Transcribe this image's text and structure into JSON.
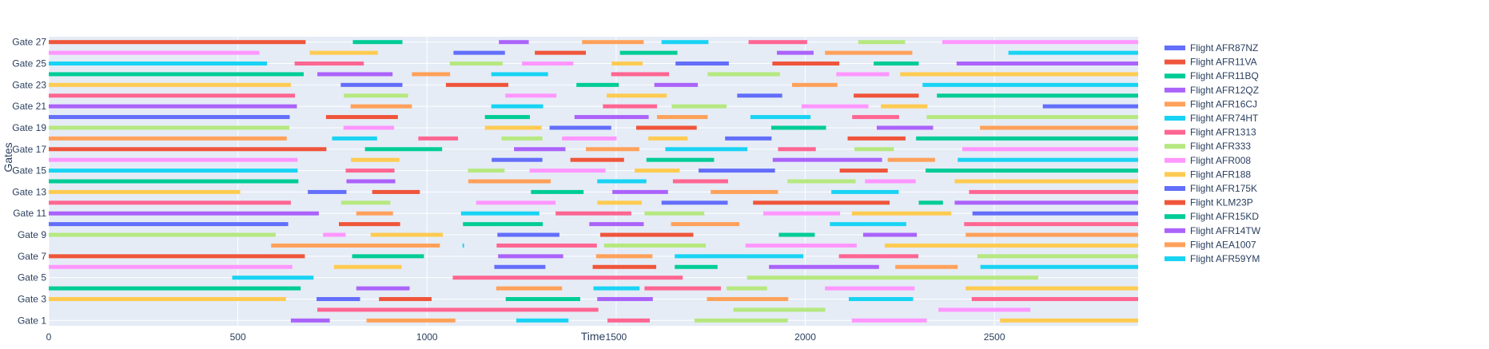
{
  "chart_data": {
    "type": "gantt",
    "title": "",
    "xlabel": "Time",
    "ylabel": "Gates",
    "xlim": [
      0,
      2880
    ],
    "ylim": [
      0.5,
      27.5
    ],
    "x_ticks": [
      0,
      500,
      1000,
      1500,
      2000,
      2500
    ],
    "y_ticks": [
      {
        "value": 1,
        "label": "Gate 1"
      },
      {
        "value": 3,
        "label": "Gate 3"
      },
      {
        "value": 5,
        "label": "Gate 5"
      },
      {
        "value": 7,
        "label": "Gate 7"
      },
      {
        "value": 9,
        "label": "Gate 9"
      },
      {
        "value": 11,
        "label": "Gate 11"
      },
      {
        "value": 13,
        "label": "Gate 13"
      },
      {
        "value": 15,
        "label": "Gate 15"
      },
      {
        "value": 17,
        "label": "Gate 17"
      },
      {
        "value": 19,
        "label": "Gate 19"
      },
      {
        "value": 21,
        "label": "Gate 21"
      },
      {
        "value": 23,
        "label": "Gate 23"
      },
      {
        "value": 25,
        "label": "Gate 25"
      },
      {
        "value": 27,
        "label": "Gate 27"
      }
    ],
    "grid": true,
    "legend_position": "right",
    "palette": [
      "#636efa",
      "#EF553B",
      "#00cc96",
      "#ab63fa",
      "#FFA15A",
      "#19d3f3",
      "#FF6692",
      "#B6E880",
      "#FF97FF",
      "#FECB52"
    ],
    "legend": [
      {
        "name": "Flight AFR87NZ",
        "color": "#636efa"
      },
      {
        "name": "Flight AFR11VA",
        "color": "#EF553B"
      },
      {
        "name": "Flight AFR11BQ",
        "color": "#00cc96"
      },
      {
        "name": "Flight AFR12QZ",
        "color": "#ab63fa"
      },
      {
        "name": "Flight AFR16CJ",
        "color": "#FFA15A"
      },
      {
        "name": "Flight AFR74HT",
        "color": "#19d3f3"
      },
      {
        "name": "Flight AFR1313",
        "color": "#FF6692"
      },
      {
        "name": "Flight AFR333",
        "color": "#B6E880"
      },
      {
        "name": "Flight AFR008",
        "color": "#FF97FF"
      },
      {
        "name": "Flight AFR188",
        "color": "#FECB52"
      },
      {
        "name": "Flight AFR175K",
        "color": "#636efa"
      },
      {
        "name": "Flight KLM23P",
        "color": "#EF553B"
      },
      {
        "name": "Flight AFR15KD",
        "color": "#00cc96"
      },
      {
        "name": "Flight AFR14TW",
        "color": "#ab63fa"
      },
      {
        "name": "Flight AEA1007",
        "color": "#FFA15A"
      },
      {
        "name": "Flight AFR59YM",
        "color": "#19d3f3"
      }
    ],
    "gates": [
      {
        "gate": 1,
        "bars": [
          [
            640,
            743
          ],
          [
            840,
            1075
          ],
          [
            1236,
            1374
          ],
          [
            1477,
            1589
          ],
          [
            1707,
            1954
          ],
          [
            2123,
            2321
          ],
          [
            2515,
            2880
          ]
        ]
      },
      {
        "gate": 2,
        "bars": [
          [
            710,
            1453
          ],
          [
            1810,
            2053
          ],
          [
            2352,
            2595
          ]
        ]
      },
      {
        "gate": 3,
        "bars": [
          [
            0,
            627
          ],
          [
            708,
            823
          ],
          [
            873,
            1012
          ],
          [
            1208,
            1405
          ],
          [
            1450,
            1597
          ],
          [
            1740,
            1955
          ],
          [
            2115,
            2285
          ],
          [
            2440,
            2880
          ]
        ]
      },
      {
        "gate": 4,
        "bars": [
          [
            0,
            666
          ],
          [
            813,
            954
          ],
          [
            1183,
            1357
          ],
          [
            1440,
            1562
          ],
          [
            1575,
            1777
          ],
          [
            1792,
            1899
          ],
          [
            2052,
            2289
          ],
          [
            2424,
            2880
          ]
        ]
      },
      {
        "gate": 5,
        "bars": [
          [
            485,
            700
          ],
          [
            1068,
            1676
          ],
          [
            1846,
            2616
          ]
        ]
      },
      {
        "gate": 6,
        "bars": [
          [
            0,
            644
          ],
          [
            754,
            933
          ],
          [
            1178,
            1313
          ],
          [
            1438,
            1606
          ],
          [
            1655,
            1768
          ],
          [
            1904,
            2195
          ],
          [
            2238,
            2403
          ],
          [
            2463,
            2880
          ]
        ]
      },
      {
        "gate": 7,
        "bars": [
          [
            0,
            677
          ],
          [
            802,
            992
          ],
          [
            1188,
            1360
          ],
          [
            1447,
            1596
          ],
          [
            1655,
            1995
          ],
          [
            2089,
            2299
          ],
          [
            2455,
            2880
          ]
        ]
      },
      {
        "gate": 8,
        "bars": [
          [
            588,
            1034
          ],
          [
            1094,
            1098
          ],
          [
            1184,
            1449
          ],
          [
            1468,
            1737
          ],
          [
            1842,
            2136
          ],
          [
            2210,
            2880
          ]
        ]
      },
      {
        "gate": 9,
        "bars": [
          [
            0,
            600
          ],
          [
            725,
            785
          ],
          [
            851,
            1042
          ],
          [
            1186,
            1350
          ],
          [
            1458,
            1704
          ],
          [
            1930,
            2025
          ],
          [
            2153,
            2295
          ],
          [
            2424,
            2880
          ]
        ]
      },
      {
        "gate": 10,
        "bars": [
          [
            0,
            633
          ],
          [
            767,
            929
          ],
          [
            1095,
            1306
          ],
          [
            1429,
            1573
          ],
          [
            1645,
            1826
          ],
          [
            2065,
            2267
          ],
          [
            2420,
            2880
          ]
        ]
      },
      {
        "gate": 11,
        "bars": [
          [
            0,
            714
          ],
          [
            813,
            910
          ],
          [
            1090,
            1297
          ],
          [
            1340,
            1540
          ],
          [
            1575,
            1733
          ],
          [
            1889,
            2092
          ],
          [
            2123,
            2386
          ],
          [
            2442,
            2880
          ]
        ]
      },
      {
        "gate": 12,
        "bars": [
          [
            0,
            640
          ],
          [
            773,
            903
          ],
          [
            1130,
            1340
          ],
          [
            1450,
            1568
          ],
          [
            1620,
            1795
          ],
          [
            1862,
            2223
          ],
          [
            2300,
            2364
          ],
          [
            2395,
            2880
          ]
        ]
      },
      {
        "gate": 13,
        "bars": [
          [
            0,
            506
          ],
          [
            685,
            787
          ],
          [
            855,
            981
          ],
          [
            1275,
            1414
          ],
          [
            1490,
            1637
          ],
          [
            1750,
            1928
          ],
          [
            2069,
            2247
          ],
          [
            2433,
            2880
          ]
        ]
      },
      {
        "gate": 14,
        "bars": [
          [
            0,
            660
          ],
          [
            787,
            916
          ],
          [
            1109,
            1327
          ],
          [
            1450,
            1580
          ],
          [
            1650,
            1796
          ],
          [
            1953,
            2133
          ],
          [
            2158,
            2292
          ],
          [
            2395,
            2880
          ]
        ]
      },
      {
        "gate": 15,
        "bars": [
          [
            0,
            658
          ],
          [
            785,
            914
          ],
          [
            1108,
            1205
          ],
          [
            1271,
            1472
          ],
          [
            1549,
            1668
          ],
          [
            1718,
            1920
          ],
          [
            2091,
            2218
          ],
          [
            2318,
            2880
          ]
        ]
      },
      {
        "gate": 16,
        "bars": [
          [
            0,
            658
          ],
          [
            799,
            927
          ],
          [
            1171,
            1305
          ],
          [
            1379,
            1521
          ],
          [
            1580,
            1759
          ],
          [
            1914,
            2203
          ],
          [
            2218,
            2343
          ],
          [
            2403,
            2880
          ]
        ]
      },
      {
        "gate": 17,
        "bars": [
          [
            0,
            734
          ],
          [
            836,
            1040
          ],
          [
            1230,
            1366
          ],
          [
            1420,
            1561
          ],
          [
            1630,
            1847
          ],
          [
            1928,
            2028
          ],
          [
            2130,
            2234
          ],
          [
            2415,
            2880
          ]
        ]
      },
      {
        "gate": 18,
        "bars": [
          [
            0,
            629
          ],
          [
            749,
            868
          ],
          [
            977,
            1082
          ],
          [
            1197,
            1305
          ],
          [
            1357,
            1501
          ],
          [
            1585,
            1689
          ],
          [
            1788,
            1911
          ],
          [
            2112,
            2265
          ],
          [
            2293,
            2880
          ]
        ]
      },
      {
        "gate": 19,
        "bars": [
          [
            0,
            636
          ],
          [
            779,
            913
          ],
          [
            1153,
            1303
          ],
          [
            1324,
            1487
          ],
          [
            1553,
            1713
          ],
          [
            1910,
            2055
          ],
          [
            2189,
            2338
          ],
          [
            2462,
            2880
          ]
        ]
      },
      {
        "gate": 20,
        "bars": [
          [
            0,
            637
          ],
          [
            733,
            923
          ],
          [
            1153,
            1272
          ],
          [
            1390,
            1586
          ],
          [
            1608,
            1742
          ],
          [
            1855,
            2014
          ],
          [
            2124,
            2248
          ],
          [
            2321,
            2880
          ]
        ]
      },
      {
        "gate": 21,
        "bars": [
          [
            0,
            656
          ],
          [
            798,
            960
          ],
          [
            1170,
            1307
          ],
          [
            1465,
            1608
          ],
          [
            1647,
            1792
          ],
          [
            1990,
            2167
          ],
          [
            2200,
            2323
          ],
          [
            2628,
            2880
          ]
        ]
      },
      {
        "gate": 22,
        "bars": [
          [
            0,
            651
          ],
          [
            780,
            950
          ],
          [
            1207,
            1342
          ],
          [
            1475,
            1634
          ],
          [
            1820,
            1939
          ],
          [
            2128,
            2300
          ],
          [
            2348,
            2880
          ]
        ]
      },
      {
        "gate": 23,
        "bars": [
          [
            0,
            640
          ],
          [
            772,
            935
          ],
          [
            1050,
            1215
          ],
          [
            1395,
            1507
          ],
          [
            1601,
            1716
          ],
          [
            1965,
            2085
          ],
          [
            2310,
            2880
          ]
        ]
      },
      {
        "gate": 24,
        "bars": [
          [
            0,
            674
          ],
          [
            710,
            909
          ],
          [
            960,
            1061
          ],
          [
            1170,
            1320
          ],
          [
            1487,
            1640
          ],
          [
            1742,
            1933
          ],
          [
            2082,
            2222
          ],
          [
            2251,
            2880
          ]
        ]
      },
      {
        "gate": 25,
        "bars": [
          [
            0,
            577
          ],
          [
            650,
            833
          ],
          [
            1060,
            1200
          ],
          [
            1251,
            1387
          ],
          [
            1488,
            1570
          ],
          [
            1657,
            1798
          ],
          [
            1913,
            2090
          ],
          [
            2181,
            2300
          ],
          [
            2400,
            2880
          ]
        ]
      },
      {
        "gate": 26,
        "bars": [
          [
            0,
            557
          ],
          [
            690,
            870
          ],
          [
            1070,
            1206
          ],
          [
            1285,
            1420
          ],
          [
            1510,
            1662
          ],
          [
            1925,
            2022
          ],
          [
            2052,
            2283
          ],
          [
            2537,
            2880
          ]
        ]
      },
      {
        "gate": 27,
        "bars": [
          [
            0,
            679
          ],
          [
            804,
            935
          ],
          [
            1190,
            1269
          ],
          [
            1410,
            1573
          ],
          [
            1620,
            1744
          ],
          [
            1850,
            2005
          ],
          [
            2140,
            2264
          ],
          [
            2362,
            2880
          ]
        ]
      }
    ]
  }
}
